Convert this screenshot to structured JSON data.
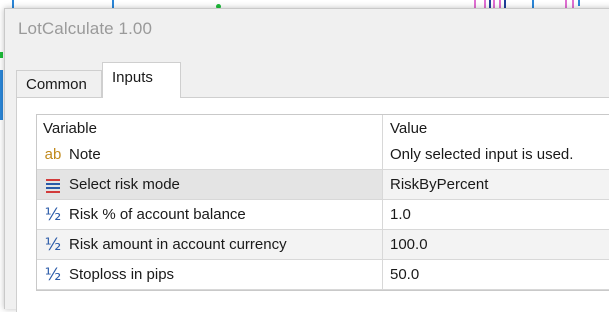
{
  "window": {
    "title": "LotCalculate 1.00"
  },
  "tabs": [
    {
      "label": "Common"
    },
    {
      "label": "Inputs"
    }
  ],
  "active_tab": "Inputs",
  "table": {
    "columns": [
      "Variable",
      "Value"
    ],
    "rows": [
      {
        "icon": "ab",
        "icon_name": "string-type-icon",
        "variable": "Note",
        "value": "Only selected input is used."
      },
      {
        "icon": "list",
        "icon_name": "enum-type-icon",
        "variable": "Select risk mode",
        "value": "RiskByPercent"
      },
      {
        "icon": "½",
        "icon_name": "double-type-icon",
        "variable": "Risk % of account balance",
        "value": "1.0"
      },
      {
        "icon": "½",
        "icon_name": "double-type-icon",
        "variable": "Risk amount in account currency",
        "value": "100.0"
      },
      {
        "icon": "½",
        "icon_name": "double-type-icon",
        "variable": "Stoploss in pips",
        "value": "50.0"
      }
    ]
  },
  "colors": {
    "string_icon": "#c18a1c",
    "double_icon": "#2a5aa8",
    "enum_icon_red": "#d23b3b",
    "enum_icon_blue": "#2a5aa8"
  }
}
